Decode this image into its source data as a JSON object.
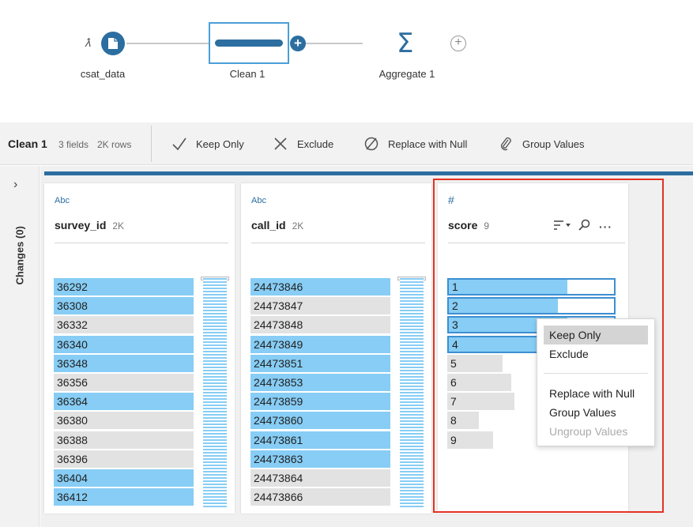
{
  "flow": {
    "nodes": [
      {
        "label": "csat_data"
      },
      {
        "label": "Clean 1"
      },
      {
        "label": "Aggregate 1"
      }
    ]
  },
  "toolbar": {
    "title": "Clean 1",
    "fields": "3 fields",
    "rows": "2K rows",
    "actions": {
      "keep_only": "Keep Only",
      "exclude": "Exclude",
      "replace_with_null": "Replace with Null",
      "group_values": "Group Values"
    }
  },
  "rail": {
    "changes_label": "Changes (0)"
  },
  "columns": {
    "survey_id": {
      "type": "Abc",
      "name": "survey_id",
      "count": "2K",
      "values": [
        "36292",
        "36308",
        "36332",
        "36340",
        "36348",
        "36356",
        "36364",
        "36380",
        "36388",
        "36396",
        "36404",
        "36412"
      ],
      "selected": [
        true,
        true,
        false,
        true,
        true,
        false,
        true,
        false,
        false,
        false,
        true,
        true
      ]
    },
    "call_id": {
      "type": "Abc",
      "name": "call_id",
      "count": "2K",
      "values": [
        "24473846",
        "24473847",
        "24473848",
        "24473849",
        "24473851",
        "24473853",
        "24473859",
        "24473860",
        "24473861",
        "24473863",
        "24473864",
        "24473866"
      ],
      "selected": [
        true,
        false,
        false,
        true,
        true,
        true,
        true,
        true,
        true,
        true,
        false,
        false
      ]
    },
    "score": {
      "type": "#",
      "name": "score",
      "count": "9",
      "values": [
        "1",
        "2",
        "3",
        "4",
        "5",
        "6",
        "7",
        "8",
        "9"
      ],
      "share": [
        0.72,
        0.66,
        0.72,
        0.62,
        0.33,
        0.38,
        0.4,
        0.19,
        0.27
      ],
      "selected": [
        true,
        true,
        true,
        true,
        false,
        false,
        false,
        false,
        false
      ]
    }
  },
  "context_menu": {
    "keep_only": "Keep Only",
    "exclude": "Exclude",
    "replace_with_null": "Replace with Null",
    "group_values": "Group Values",
    "ungroup_values": "Ungroup Values"
  },
  "colors": {
    "accent": "#2c6ea0",
    "selected_bar": "#87cdf5",
    "unselected_bar": "#e2e2e2",
    "highlight": "#e53222"
  }
}
